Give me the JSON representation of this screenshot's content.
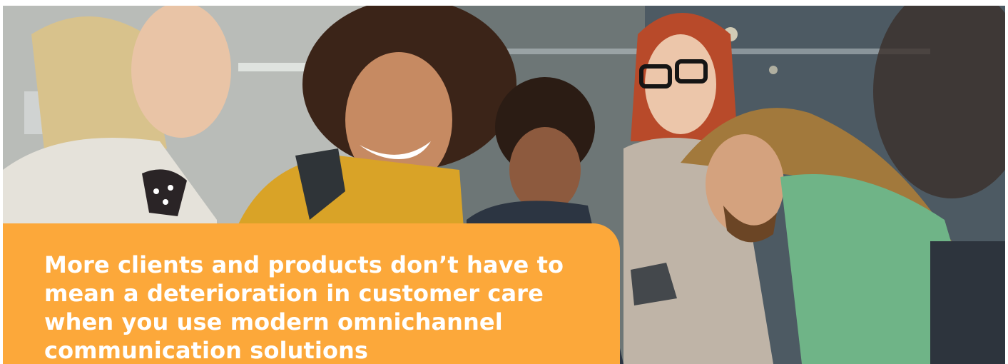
{
  "hero": {
    "photo_alt": "photo",
    "caption": "More clients and products don’t have to mean a deterioration in customer care when you use modern omnichannel communication solutions"
  },
  "colors": {
    "caption_background": "#fca83a",
    "caption_text": "#ffffff"
  }
}
